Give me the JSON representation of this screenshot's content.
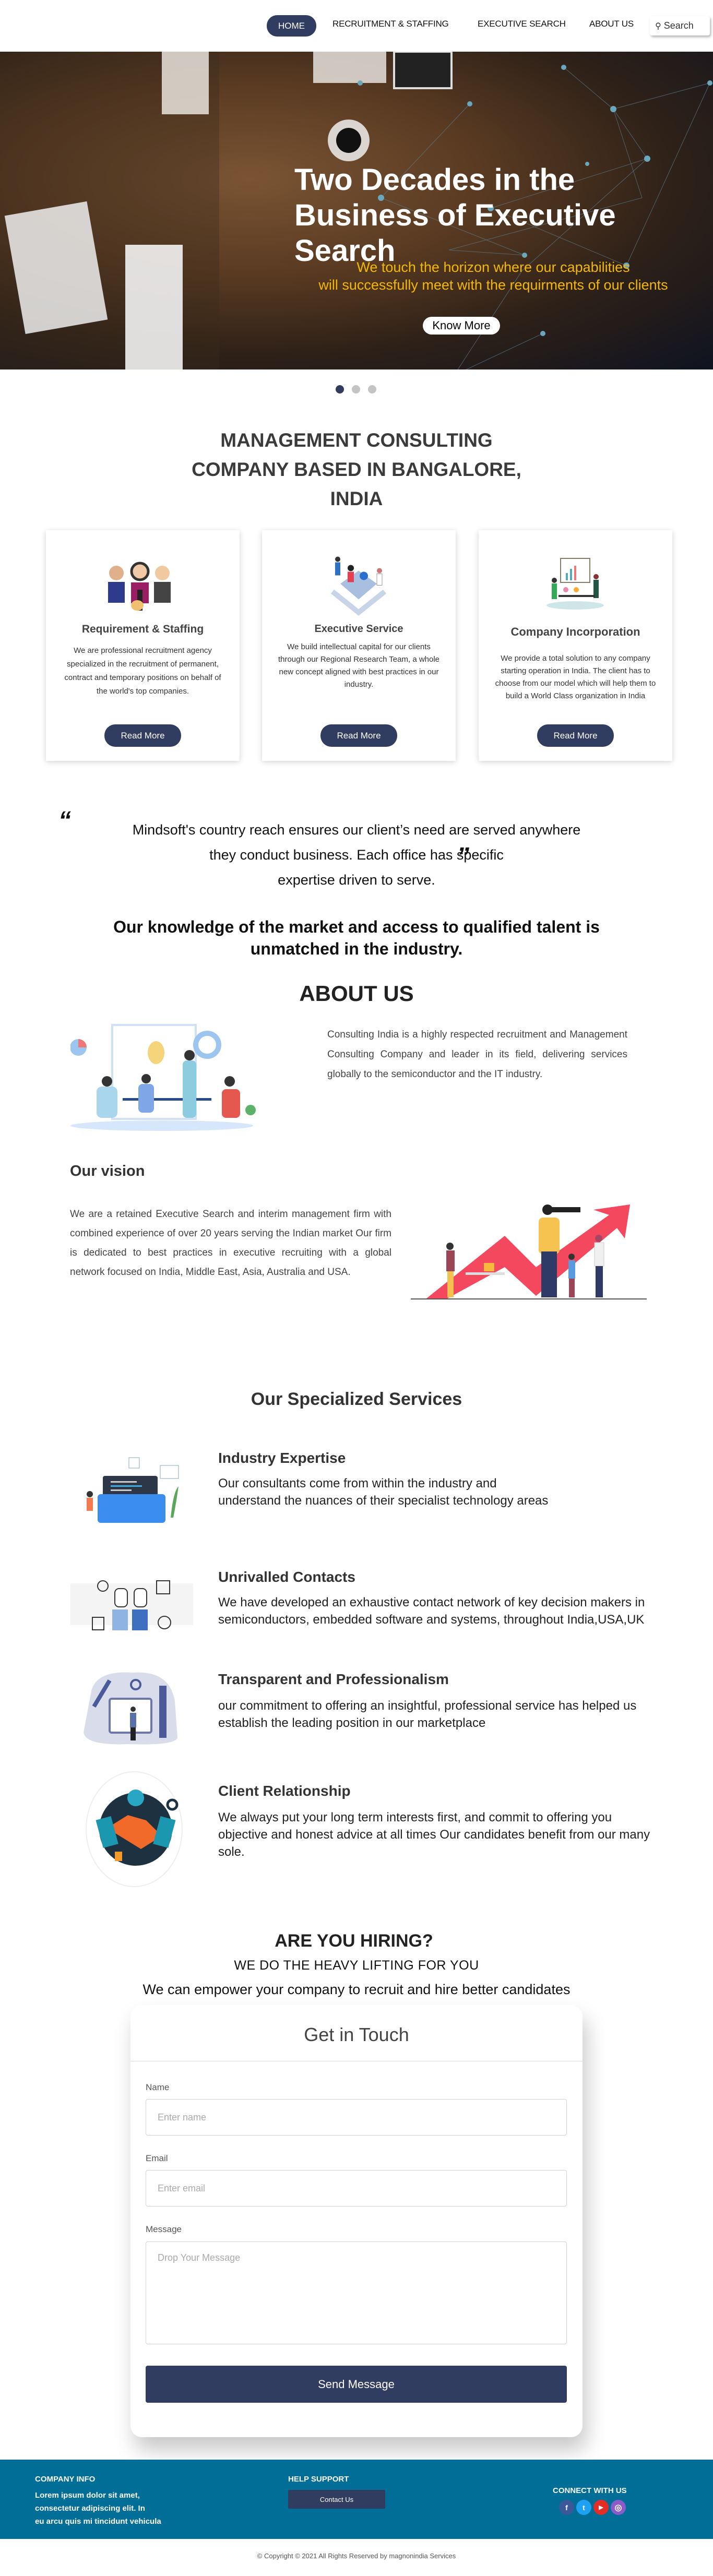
{
  "nav": {
    "items": [
      "HOME",
      "RECRUITMENT & STAFFING",
      "EXECUTIVE SEARCH",
      "ABOUT US"
    ],
    "active": "HOME",
    "search_label": "Search",
    "accent": "#313c61"
  },
  "hero": {
    "title_line1": "Two Decades in the",
    "title_line2": "Business of Executive Search",
    "subtitle_line1": "We touch the horizon where our capabilities",
    "subtitle_line2": "will successfully meet with the requirments of our clients",
    "cta": "Know More",
    "subtitle_color": "#f5b800",
    "carousel": {
      "slides": 3,
      "active": 1
    }
  },
  "intro": {
    "heading_line1": "MANAGEMENT CONSULTING",
    "heading_line2": "COMPANY BASED IN BANGALORE,",
    "heading_line3": "INDIA"
  },
  "cards": [
    {
      "title": "Requirement & Staffing",
      "text": "We are professional recruitment agency specialized in the recruitment of permanent, contract and temporary positions on behalf of the world's top companies.",
      "button": "Read More",
      "icon": "recruitment-magnifier-illustration"
    },
    {
      "title": "Executive Service",
      "text": "We build intellectual capital for our clients through our Regional Research Team, a whole new concept aligned with best practices in our industry.",
      "button": "Read More",
      "icon": "executive-team-illustration"
    },
    {
      "title": "Company Incorporation",
      "text": "We provide a total solution to any company starting operation in India. The client has to choose from our model which will help them to build a World Class organization in India",
      "button": "Read More",
      "icon": "presentation-meeting-illustration"
    }
  ],
  "quote": {
    "line1": "Mindsoft's country reach ensures our client’s need are served anywhere",
    "line2": "they conduct business. Each office has specific",
    "line3": "expertise driven to serve.",
    "open_mark": "“",
    "close_mark": "”"
  },
  "tagline": {
    "line1": "Our knowledge of the market and access to qualified talent is",
    "line2": "unmatched in the industry."
  },
  "about": {
    "heading": "ABOUT US",
    "text": "Consulting India is a highly respected recruitment and Management Consulting Company and leader in its field, delivering services globally to the semiconductor and the IT industry.",
    "vision_heading": "Our vision",
    "vision_text": "We are a retained Executive Search and interim management firm with combined experience of over 20 years serving the Indian market Our firm is dedicated to best practices in executive recruiting with a global network focused on India, Middle East, Asia, Australia and USA."
  },
  "services": {
    "heading": "Our Specialized Services",
    "items": [
      {
        "title": "Industry Expertise",
        "text": "Our consultants come from within the industry and understand the nuances of their specialist technology areas"
      },
      {
        "title": "Unrivalled Contacts",
        "text": "We have developed an exhaustive contact network of key decision makers in semiconductors, embedded software and systems, throughout India,USA,UK"
      },
      {
        "title": "Transparent and Professionalism",
        "text": "our commitment to offering an insightful, professional service has helped us establish the leading position in our marketplace"
      },
      {
        "title": "Client Relationship",
        "text": "We always put your long term interests first, and commit to offering you objective and honest advice at all times Our candidates benefit from our many sole."
      }
    ]
  },
  "hiring": {
    "heading": "ARE YOU HIRING?",
    "subheading": "WE DO THE HEAVY LIFTING FOR YOU",
    "text": "We can empower your company to recruit and hire better candidates"
  },
  "contact_form": {
    "title": "Get in Touch",
    "name_label": "Name",
    "name_placeholder": "Enter name",
    "name_value": "",
    "email_label": "Email",
    "email_placeholder": "Enter email",
    "email_value": "",
    "message_label": "Message",
    "message_placeholder": "Drop Your Message",
    "message_value": "",
    "submit": "Send Message"
  },
  "footer": {
    "background": "#006e96",
    "company_heading": "COMPANY INFO",
    "company_line1": "Lorem ipsum dolor sit amet,",
    "company_line2": "consectetur adipiscing elit. In",
    "company_line3": "eu arcu quis mi tincidunt vehicula",
    "help_heading": "HELP SUPPORT",
    "contact_button": "Contact Us",
    "connect_heading": "CONNECT WITH US",
    "social": [
      {
        "name": "facebook",
        "glyph": "f",
        "color": "#3b5998"
      },
      {
        "name": "twitter",
        "glyph": "t",
        "color": "#1da1f2"
      },
      {
        "name": "youtube",
        "glyph": "▶",
        "color": "#e52d27"
      },
      {
        "name": "instagram",
        "glyph": "◎",
        "color": "#8a5cc9"
      }
    ],
    "copyright": "Copyright © 2021 All Rights Reserved by magnonindia Services",
    "copyright_icon": "©"
  }
}
